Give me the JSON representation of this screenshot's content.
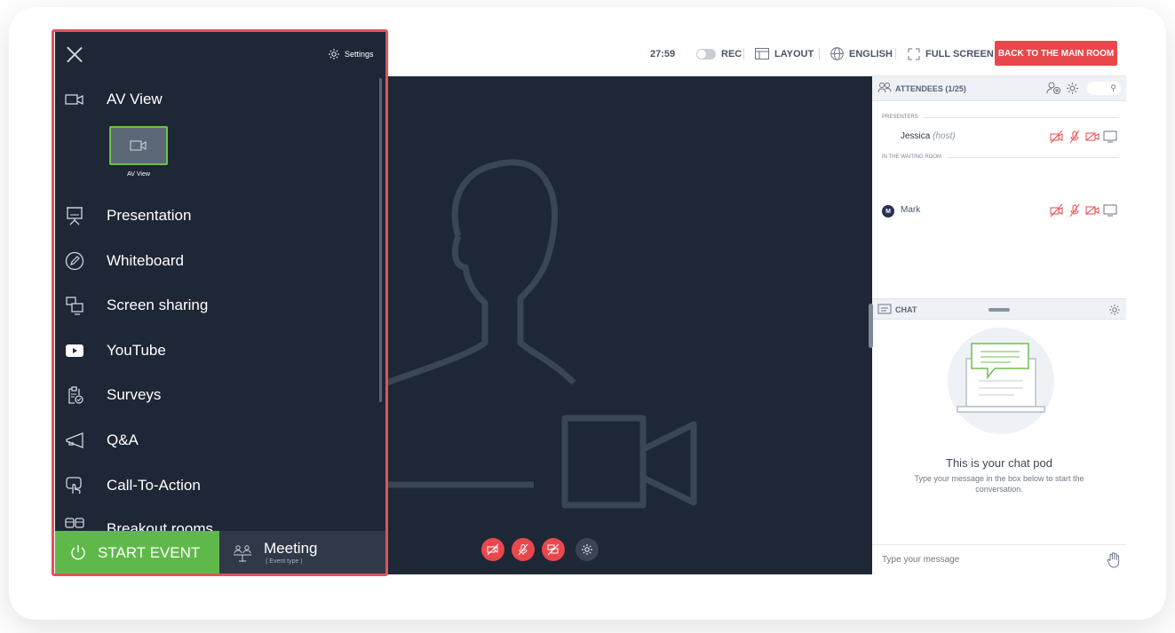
{
  "topbar": {
    "timer": "27:59",
    "rec_label": "REC",
    "layout_label": "LAYOUT",
    "language_label": "ENGLISH",
    "fullscreen_label": "FULL SCREEN",
    "back_button_label": "BACK TO THE MAIN ROOM"
  },
  "left_panel": {
    "settings_label": "Settings",
    "av_thumbnail_label": "AV View",
    "menu": [
      {
        "label": "AV View",
        "icon": "video-camera-icon"
      },
      {
        "label": "Presentation",
        "icon": "presentation-board-icon"
      },
      {
        "label": "Whiteboard",
        "icon": "pencil-circle-icon"
      },
      {
        "label": "Screen sharing",
        "icon": "screen-sharing-icon"
      },
      {
        "label": "YouTube",
        "icon": "youtube-icon"
      },
      {
        "label": "Surveys",
        "icon": "clipboard-check-icon"
      },
      {
        "label": "Q&A",
        "icon": "megaphone-icon"
      },
      {
        "label": "Call-To-Action",
        "icon": "pointer-hand-icon"
      },
      {
        "label": "Breakout rooms",
        "icon": "breakout-rooms-icon"
      }
    ],
    "start_event_label": "START EVENT",
    "event_type_title": "Meeting",
    "event_type_sub": "( Event type )"
  },
  "attendees": {
    "title": "ATTENDEES (1/25)",
    "presenters_label": "PRESENTERS",
    "waiting_label": "IN THE WAITING ROOM",
    "presenter": {
      "name": "Jessica",
      "role": "(host)"
    },
    "waiting": {
      "name": "Mark",
      "initial": "M"
    }
  },
  "chat": {
    "title": "CHAT",
    "empty_title": "This is your chat pod",
    "empty_sub": "Type your message in the box below to start the conversation.",
    "input_placeholder": "Type your message"
  },
  "colors": {
    "accent_red": "#e8484c",
    "start_green": "#5fb94a",
    "panel_dark": "#1e2735",
    "highlight_border": "#e0525a"
  }
}
